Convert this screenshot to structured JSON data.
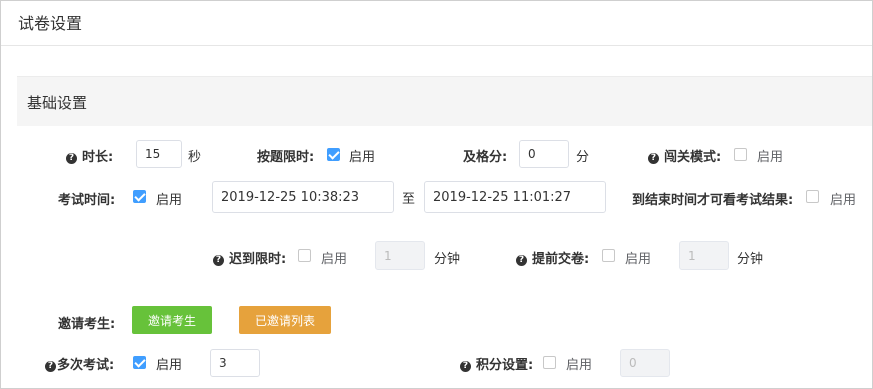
{
  "page": {
    "title": "试卷设置"
  },
  "section": {
    "title": "基础设置"
  },
  "common": {
    "enable": "启用"
  },
  "duration": {
    "label": "时长:",
    "value": "15",
    "unit": "秒"
  },
  "per_question_limit": {
    "label": "按题限时:",
    "checked": true
  },
  "pass_score": {
    "label": "及格分:",
    "value": "0",
    "unit": "分"
  },
  "level_mode": {
    "label": "闯关模式:",
    "checked": false
  },
  "exam_time": {
    "label": "考试时间:",
    "checked": true,
    "start": "2019-12-25 10:38:23",
    "separator": "至",
    "end": "2019-12-25 11:01:27"
  },
  "view_result_after_end": {
    "label": "到结束时间才可看考试结果:",
    "checked": false
  },
  "late_limit": {
    "label": "迟到限时:",
    "checked": false,
    "value": "1",
    "unit": "分钟"
  },
  "early_submit": {
    "label": "提前交卷:",
    "checked": false,
    "value": "1",
    "unit": "分钟"
  },
  "invite": {
    "label": "邀请考生:",
    "invite_button": "邀请考生",
    "list_button": "已邀请列表",
    "invite_color": "#67c23a",
    "list_color": "#e6a23c"
  },
  "multi_attempt": {
    "label": "多次考试:",
    "checked": true,
    "value": "3"
  },
  "points": {
    "label": "积分设置:",
    "checked": false,
    "value": "0"
  },
  "colors": {
    "accent": "#409eff"
  }
}
